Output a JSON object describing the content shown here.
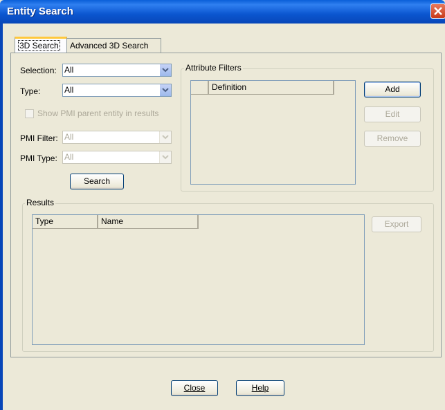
{
  "window": {
    "title": "Entity Search"
  },
  "tabs": [
    {
      "label": "3D Search"
    },
    {
      "label": "Advanced 3D Search"
    }
  ],
  "form": {
    "selection_label": "Selection:",
    "selection_value": "All",
    "type_label": "Type:",
    "type_value": "All",
    "show_pmi_label": "Show PMI parent entity in results",
    "show_pmi_checked": false,
    "pmi_filter_label": "PMI Filter:",
    "pmi_filter_value": "All",
    "pmi_type_label": "PMI Type:",
    "pmi_type_value": "All",
    "search_button": "Search"
  },
  "attribute_filters": {
    "legend": "Attribute Filters",
    "columns": [
      "",
      "Definition"
    ],
    "add_button": "Add",
    "edit_button": "Edit",
    "remove_button": "Remove"
  },
  "results": {
    "legend": "Results",
    "columns": [
      "Type",
      "Name"
    ],
    "export_button": "Export"
  },
  "footer": {
    "close_button": "Close",
    "help_button": "Help"
  },
  "colors": {
    "titlebar": "#0b56d0",
    "dialog_bg": "#ece9d8",
    "active_tab_accent": "#ffc83c"
  }
}
